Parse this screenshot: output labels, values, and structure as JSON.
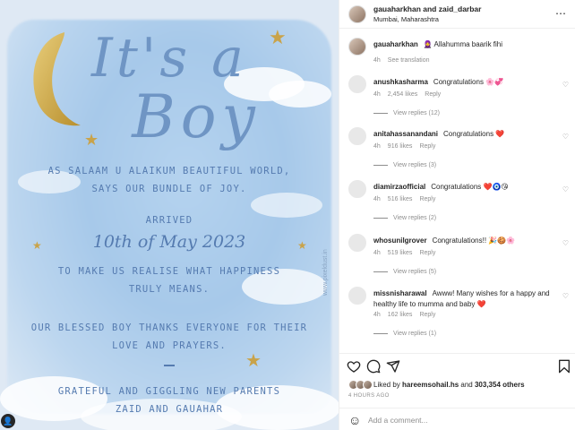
{
  "post_image": {
    "headline_1": "It's a",
    "headline_2": "Boy",
    "line_1": "As salaam u alaikum beautiful world,",
    "line_2": "says our bundle of joy.",
    "arrived": "Arrived",
    "date": "10th of May 2023",
    "line_3": "To make us realise what happiness",
    "line_4": "truly means.",
    "line_5": "Our blessed boy thanks everyone for their",
    "line_6": "love and prayers.",
    "line_7": "Grateful and giggling new parents",
    "line_8": "Zaid and Gauahar",
    "watermark": "www.pixeldust.in",
    "colors": {
      "text_blue": "#557bb0",
      "title_blue": "#6f95c4",
      "gold": "#c9a34a",
      "wash": "#a7c9ea"
    }
  },
  "header": {
    "title": "gauaharkhan and zaid_darbar",
    "location": "Mumbai, Maharashtra",
    "more_icon": "⋯"
  },
  "comments": [
    {
      "user": "gauaharkhan",
      "text": "🧕 Allahumma baarik fihi",
      "time": "4h",
      "extra": "See translation",
      "likes": "",
      "reply": "",
      "replies": ""
    },
    {
      "user": "anushkasharma",
      "text": "Congratulations 🌸💞",
      "time": "4h",
      "likes": "2,454 likes",
      "reply": "Reply",
      "replies": "View replies (12)"
    },
    {
      "user": "anitahassanandani",
      "text": "Congratulations ❤️",
      "time": "4h",
      "likes": "916 likes",
      "reply": "Reply",
      "replies": "View replies (3)"
    },
    {
      "user": "diamirzaofficial",
      "text": "Congratulations ❤️🧿😘",
      "time": "4h",
      "likes": "516 likes",
      "reply": "Reply",
      "replies": "View replies (2)"
    },
    {
      "user": "whosunilgrover",
      "text": "Congratulations!! 🎉🍪🌸",
      "time": "4h",
      "likes": "519 likes",
      "reply": "Reply",
      "replies": "View replies (5)"
    },
    {
      "user": "missnisharawal",
      "text": "Awww! Many wishes for a happy and healthy life to mumma and baby ❤️",
      "time": "4h",
      "likes": "162 likes",
      "reply": "Reply",
      "replies": "View replies (1)"
    }
  ],
  "actions": {
    "like_icon": "heart-outline-icon",
    "comment_icon": "comment-icon",
    "share_icon": "share-icon",
    "save_icon": "bookmark-icon",
    "liked_by_prefix": "Liked by ",
    "liked_by_user": "hareemsohail.hs",
    "liked_by_and": " and ",
    "liked_by_others": "303,354 others",
    "timestamp": "4 HOURS AGO"
  },
  "add_comment": {
    "placeholder": "Add a comment..."
  }
}
